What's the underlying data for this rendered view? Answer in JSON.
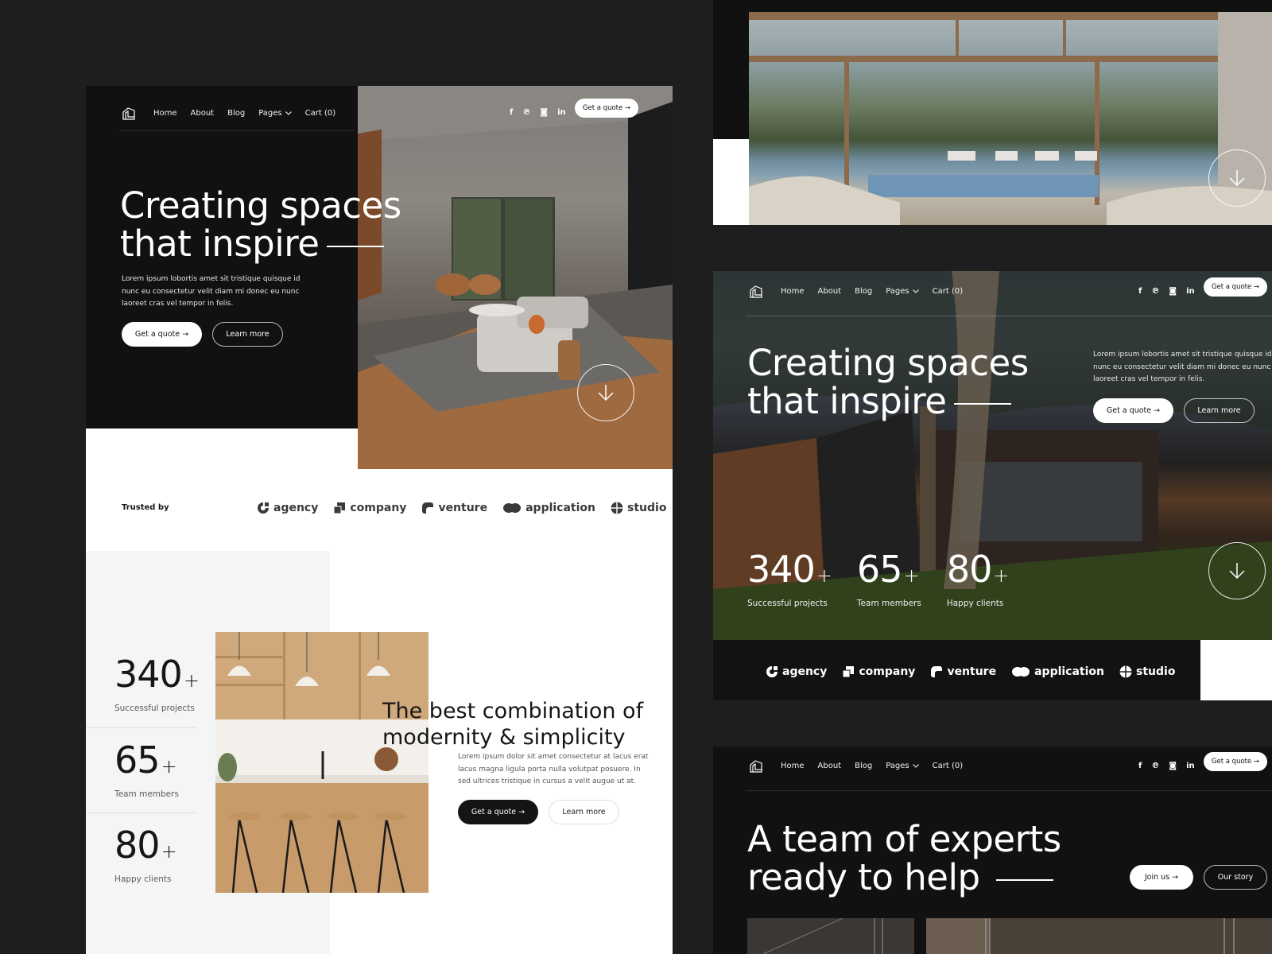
{
  "nav": {
    "items": [
      "Home",
      "About",
      "Blog",
      "Pages",
      "Cart (0)"
    ],
    "cta": "Get a quote →",
    "social": [
      "facebook-icon",
      "pinterest-icon",
      "instagram-icon",
      "linkedin-icon"
    ]
  },
  "hero": {
    "title_line1": "Creating spaces",
    "title_line2": "that inspire",
    "description": "Lorem ipsum lobortis amet sit tristique quisque id nunc eu consectetur velit diam mi donec eu nunc laoreet cras vel tempor in felis.",
    "primary_button": "Get a quote →",
    "secondary_button": "Learn more"
  },
  "trusted": {
    "label": "Trusted by",
    "brands": [
      "agency",
      "company",
      "venture",
      "application",
      "studio"
    ]
  },
  "stats": [
    {
      "value": "340",
      "suffix": "+",
      "label": "Successful projects"
    },
    {
      "value": "65",
      "suffix": "+",
      "label": "Team members"
    },
    {
      "value": "80",
      "suffix": "+",
      "label": "Happy clients"
    }
  ],
  "feature": {
    "title_line1": "The best combination of",
    "title_line2": "modernity & simplicity",
    "description": "Lorem ipsum dolor sit amet consectetur at lacus erat lacus magna ligula porta nulla volutpat posuere. In sed ultrices tristique in cursus a velit augue ut at.",
    "primary_button": "Get a quote →",
    "secondary_button": "Learn more"
  },
  "team": {
    "title_line1": "A team of experts",
    "title_line2": "ready to help",
    "primary_button": "Join us →",
    "secondary_button": "Our story"
  },
  "colors": {
    "background": "#1e1e1f",
    "dark_panel": "#121111",
    "light_panel": "#f4f5f7",
    "accent_white": "#ffffff"
  }
}
